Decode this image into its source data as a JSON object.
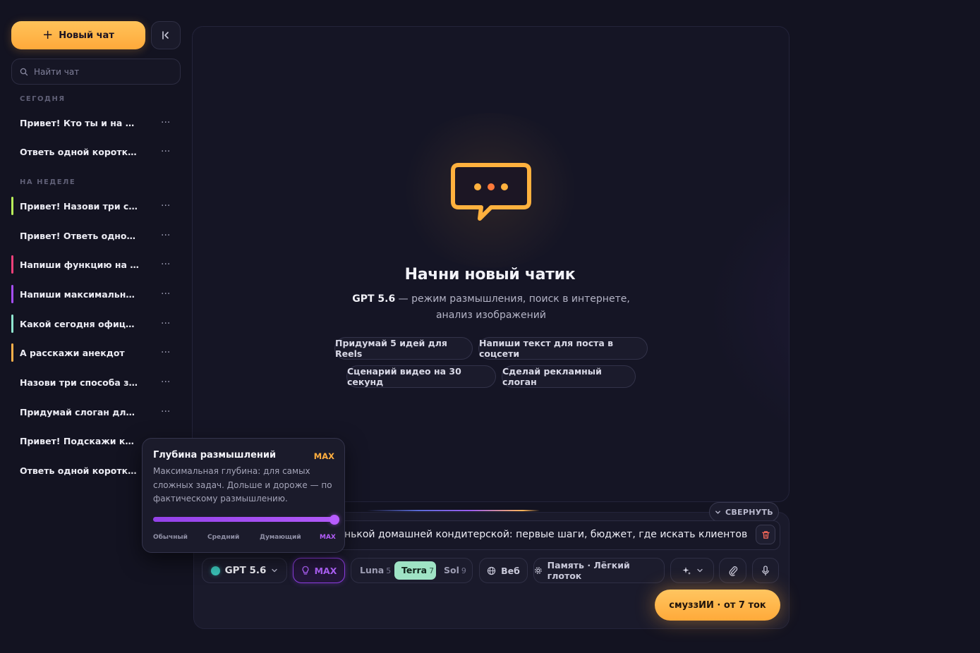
{
  "sidebar": {
    "new_chat_label": "Новый чат",
    "search_placeholder": "Найти чат",
    "sections": [
      {
        "label": "СЕГОДНЯ",
        "items": [
          {
            "title": "Привет! Кто ты и на как...",
            "accent": ""
          },
          {
            "title": "Ответь одной короткой ...",
            "accent": ""
          }
        ]
      },
      {
        "label": "НА НЕДЕЛЕ",
        "items": [
          {
            "title": "Привет! Назови три све...",
            "accent": "#b8f05a"
          },
          {
            "title": "Привет! Ответь одной ф...",
            "accent": ""
          },
          {
            "title": "Напиши функцию на Pyt...",
            "accent": "#f0407a"
          },
          {
            "title": "Напиши максимально п...",
            "accent": "#a54ef5"
          },
          {
            "title": "Какой сегодня официал...",
            "accent": "#8fe6d0"
          },
          {
            "title": "А расскажи анекдот",
            "accent": "#ffb04a"
          },
          {
            "title": "Назови три способа зав...",
            "accent": ""
          },
          {
            "title": "Придумай слоган для с...",
            "accent": ""
          },
          {
            "title": "Привет! Подскажи коро...",
            "accent": ""
          },
          {
            "title": "Ответь одной короткой ...",
            "accent": ""
          }
        ]
      }
    ],
    "item_menu_icon": "dots-horizontal-icon"
  },
  "hero": {
    "title": "Начни новый чатик",
    "subtitle_model": "GPT 5.6",
    "subtitle_line1": " — режим размышления, поиск в интернете,",
    "subtitle_line2": "анализ изображений",
    "suggestions": [
      "Придумай 5 идей для Reels",
      "Напиши текст для поста в соцсети",
      "Сценарий видео на 30 секунд",
      "Сделай рекламный слоган"
    ]
  },
  "composer": {
    "collapse_label": "СВЕРНУТЬ",
    "prompt_text": "нькой домашней кондитерской: первые шаги, бюджет, где искать клиентов",
    "model_label": "GPT 5.6",
    "model_color": "#3ac3b8",
    "reasoning_label": "MAX",
    "tiers": [
      {
        "name": "Luna",
        "count": "5"
      },
      {
        "name": "Terra",
        "count": "7"
      },
      {
        "name": "Sol",
        "count": "9"
      }
    ],
    "selected_tier": "Terra",
    "web_label": "Веб",
    "memory_label": "Память · Лёгкий глоток",
    "send_label": "смуззИИ · от 7 ток"
  },
  "reasoning_popover": {
    "title": "Глубина размышлений",
    "badge": "MAX",
    "description": "Максимальная глубина: для самых сложных задач. Дольше и дороже — по фактическому размышлению.",
    "levels": [
      "Обычный",
      "Средний",
      "Думающий",
      "MAX"
    ],
    "selected_level": "MAX",
    "slider_value_percent": 100
  },
  "colors": {
    "accent_orange": "#ffae3f",
    "accent_purple": "#a54ef5",
    "tier_active": "#9fe3c5",
    "background": "#131321"
  }
}
